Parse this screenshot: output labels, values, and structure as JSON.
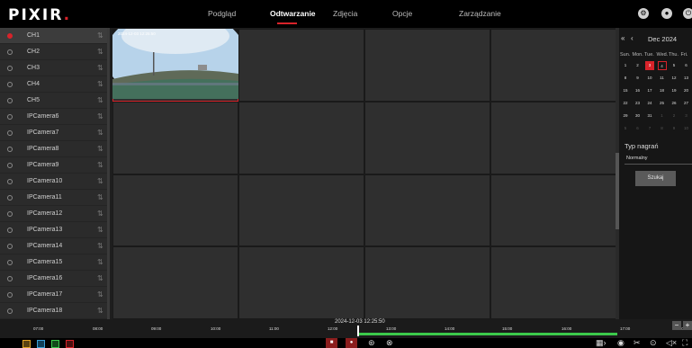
{
  "app": {
    "logo_text": "PIXIR",
    "logo_dot": "."
  },
  "nav": [
    {
      "label": "Podgląd"
    },
    {
      "label": "Odtwarzanie",
      "active": true
    },
    {
      "label": "Zdjęcia"
    },
    {
      "label": "Opcje"
    },
    {
      "label": "Zarządzanie"
    }
  ],
  "top_icons": [
    "settings-icon",
    "user-icon",
    "power-icon"
  ],
  "cameras": [
    {
      "label": "CH1",
      "selected": true,
      "status": "red"
    },
    {
      "label": "CH2"
    },
    {
      "label": "CH3"
    },
    {
      "label": "CH4"
    },
    {
      "label": "CH5"
    },
    {
      "label": "IPCamera6"
    },
    {
      "label": "IPCamera7"
    },
    {
      "label": "IPCamera8"
    },
    {
      "label": "IPCamera9"
    },
    {
      "label": "IPCamera10"
    },
    {
      "label": "IPCamera11"
    },
    {
      "label": "IPCamera12"
    },
    {
      "label": "IPCamera13"
    },
    {
      "label": "IPCamera14"
    },
    {
      "label": "IPCamera15"
    },
    {
      "label": "IPCamera16"
    },
    {
      "label": "IPCamera17"
    },
    {
      "label": "IPCamera18"
    }
  ],
  "playback": {
    "thumbnail_timestamp": "2024-12-03 12:25:50"
  },
  "calendar": {
    "prev_year": "«",
    "prev_month": "‹",
    "month": "Dec  2024",
    "weekdays": [
      "Sun.",
      "Mon.",
      "Tue.",
      "Wed.",
      "Thu.",
      "Fri."
    ],
    "rows": [
      [
        "1",
        "2",
        "3",
        "4",
        "5",
        "6"
      ],
      [
        "8",
        "9",
        "10",
        "11",
        "12",
        "13"
      ],
      [
        "15",
        "16",
        "17",
        "18",
        "19",
        "20"
      ],
      [
        "22",
        "23",
        "24",
        "25",
        "26",
        "27"
      ],
      [
        "29",
        "30",
        "31",
        "1",
        "2",
        "3"
      ],
      [
        "5",
        "6",
        "7",
        "8",
        "9",
        "10"
      ]
    ],
    "recorded_day": "3",
    "selected_day": "4"
  },
  "search": {
    "record_type_label": "Typ nagrań",
    "record_type_value": "Normalny",
    "search_button": "Szukaj"
  },
  "timeline": {
    "current_time": "2024-12-03 12:25:50",
    "ticks": [
      "07:00",
      "08:00",
      "09:00",
      "10:00",
      "11:00",
      "12:00",
      "13:00",
      "14:00",
      "15:00",
      "16:00",
      "17:00",
      "18:00"
    ],
    "zoom_out": "−",
    "zoom_in": "+"
  },
  "colors": {
    "accent": "#d8232a",
    "recording": "#3cc94b"
  }
}
